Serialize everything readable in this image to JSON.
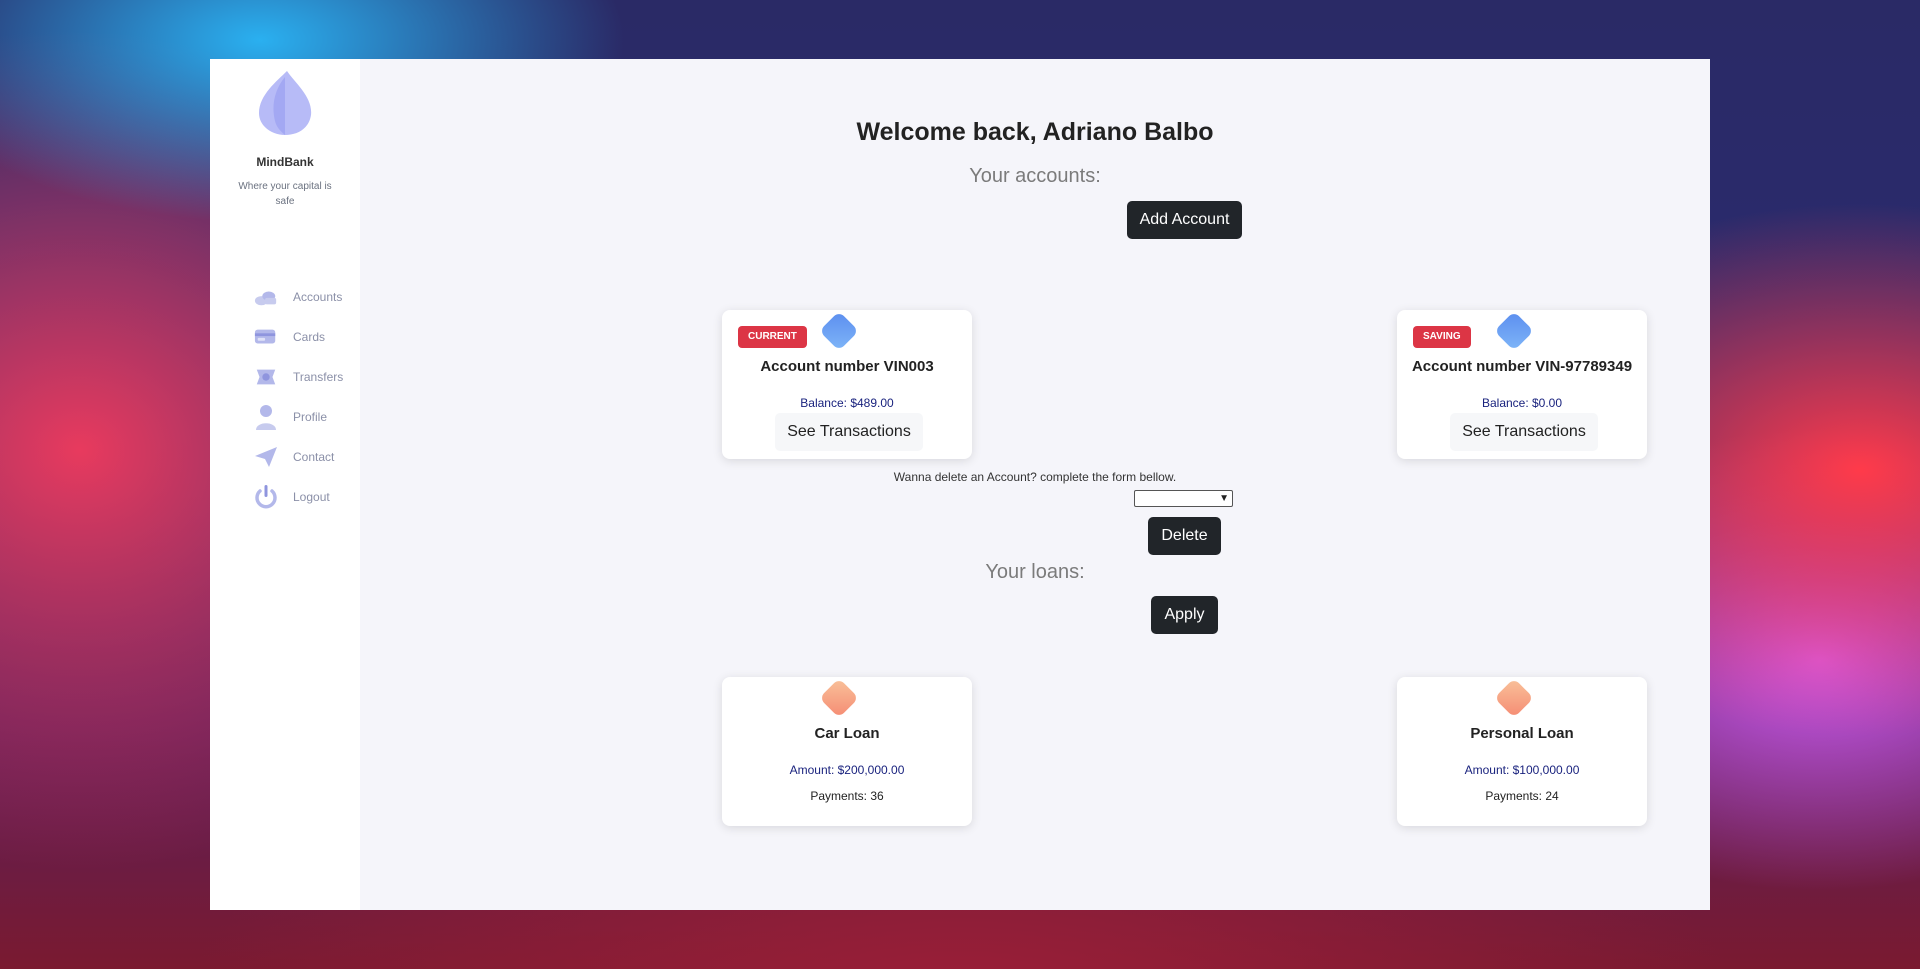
{
  "sidebar": {
    "brand": "MindBank",
    "tagline": "Where your capital is safe",
    "items": [
      {
        "label": "Accounts",
        "icon": "coins-icon"
      },
      {
        "label": "Cards",
        "icon": "card-icon"
      },
      {
        "label": "Transfers",
        "icon": "transfer-icon"
      },
      {
        "label": "Profile",
        "icon": "user-icon"
      },
      {
        "label": "Contact",
        "icon": "paper-plane-icon"
      },
      {
        "label": "Logout",
        "icon": "power-icon"
      }
    ]
  },
  "main": {
    "welcome": "Welcome back, Adriano Balbo",
    "accounts_heading": "Your accounts:",
    "add_account_label": "Add Account",
    "accounts": [
      {
        "type": "CURRENT",
        "number": "Account number VIN003",
        "balance": "Balance: $489.00",
        "action": "See Transactions"
      },
      {
        "type": "SAVING",
        "number": "Account number VIN-97789349",
        "balance": "Balance: $0.00",
        "action": "See Transactions"
      }
    ],
    "delete_prompt": "Wanna delete an Account? complete the form bellow.",
    "delete_select_value": "",
    "delete_label": "Delete",
    "loans_heading": "Your loans:",
    "apply_label": "Apply",
    "loans": [
      {
        "name": "Car Loan",
        "amount": "Amount: $200,000.00",
        "payments": "Payments: 36"
      },
      {
        "name": "Personal Loan",
        "amount": "Amount: $100,000.00",
        "payments": "Payments: 24"
      }
    ]
  },
  "colors": {
    "badge": "#dc3545",
    "button": "#212529",
    "accent_blue": "#5b8def",
    "accent_orange": "#f58b73"
  }
}
